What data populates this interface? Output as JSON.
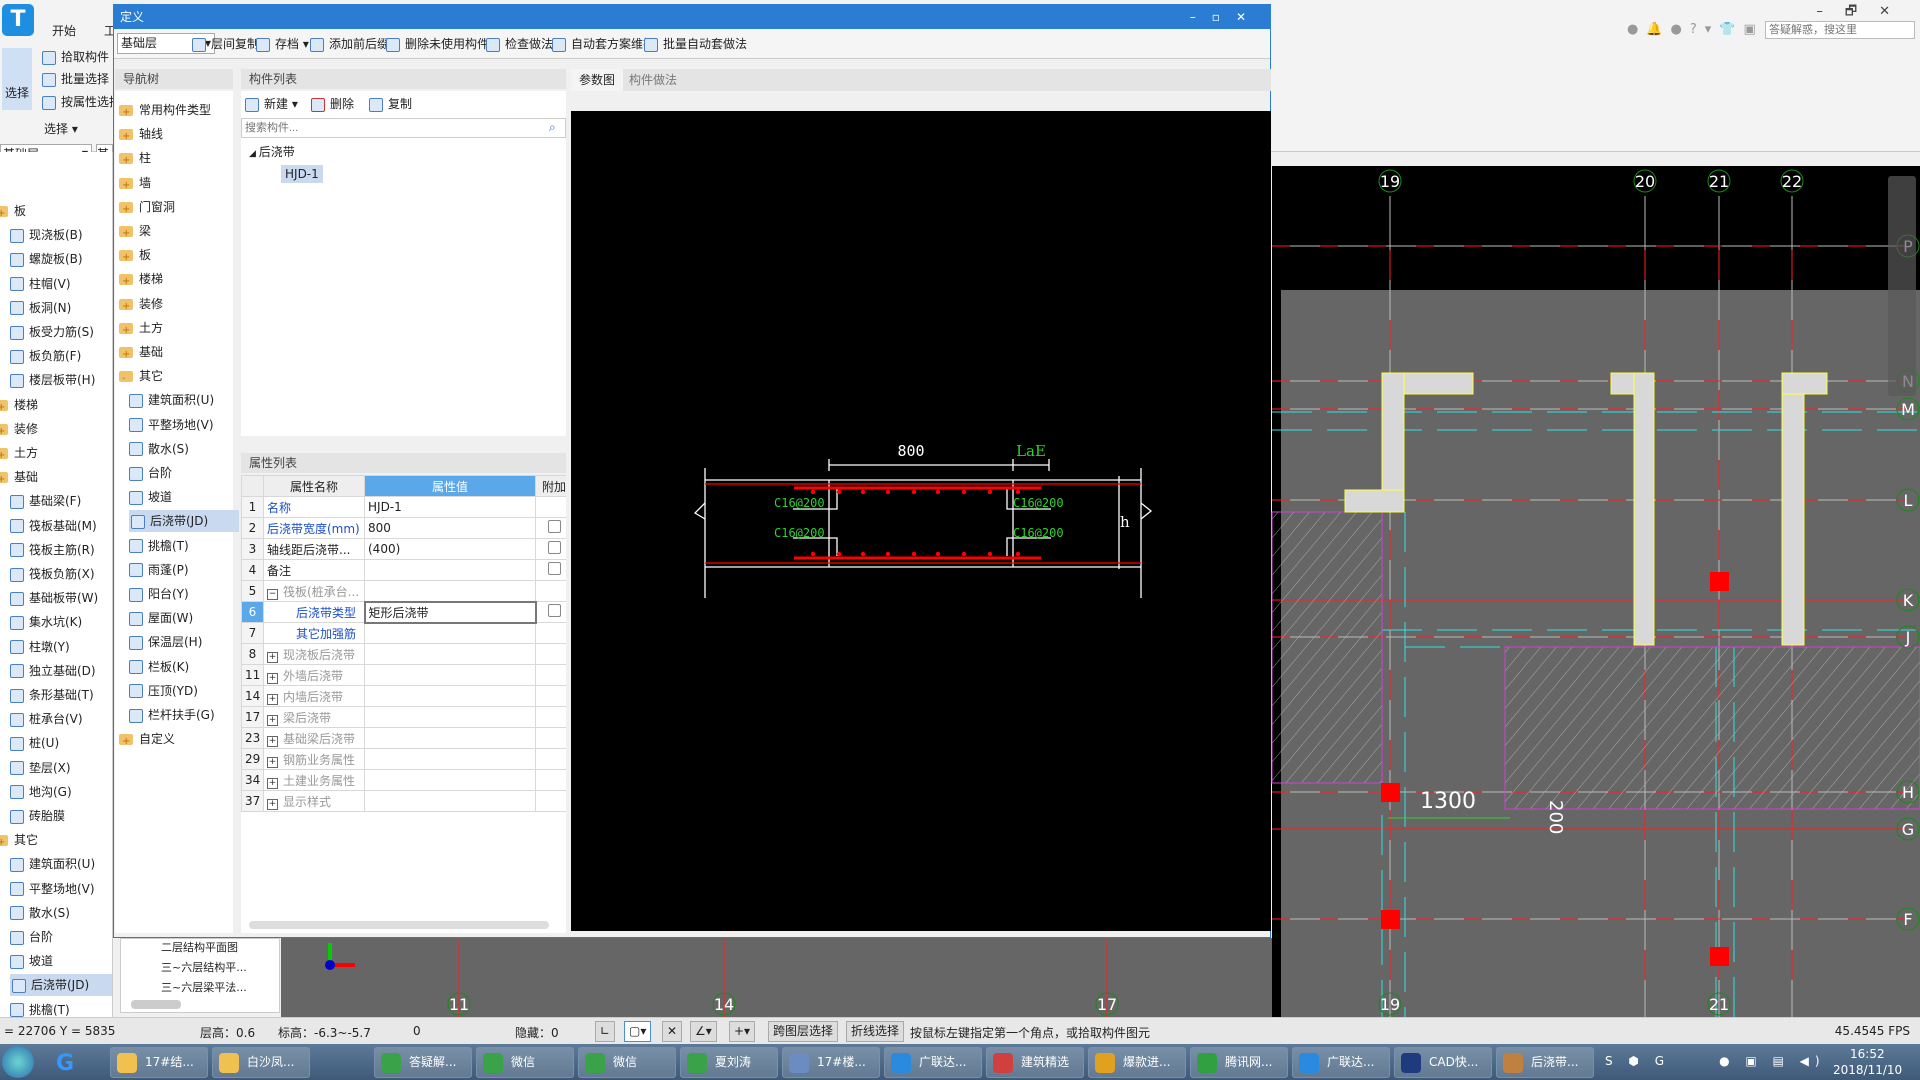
{
  "ribbon": {
    "tabs": [
      "开始",
      "工"
    ],
    "select_big": "选择",
    "buttons": [
      "拾取构件",
      "批量选择",
      "按属性选择"
    ],
    "group": "选择 ▾",
    "floor": "基础层",
    "floor2": "其",
    "search_placeholder": "答疑解惑，搜这里",
    "window_controls": [
      "–",
      "🗗",
      "✕"
    ]
  },
  "left_tree": [
    {
      "t": "板",
      "f": 1
    },
    {
      "t": "现浇板(B)"
    },
    {
      "t": "螺旋板(B)"
    },
    {
      "t": "柱帽(V)"
    },
    {
      "t": "板洞(N)"
    },
    {
      "t": "板受力筋(S)"
    },
    {
      "t": "板负筋(F)"
    },
    {
      "t": "楼层板带(H)"
    },
    {
      "t": "楼梯",
      "f": 1
    },
    {
      "t": "装修",
      "f": 1
    },
    {
      "t": "土方",
      "f": 1
    },
    {
      "t": "基础",
      "f": 1
    },
    {
      "t": "基础梁(F)"
    },
    {
      "t": "筏板基础(M)"
    },
    {
      "t": "筏板主筋(R)"
    },
    {
      "t": "筏板负筋(X)"
    },
    {
      "t": "基础板带(W)"
    },
    {
      "t": "集水坑(K)"
    },
    {
      "t": "柱墩(Y)"
    },
    {
      "t": "独立基础(D)"
    },
    {
      "t": "条形基础(T)"
    },
    {
      "t": "桩承台(V)"
    },
    {
      "t": "桩(U)"
    },
    {
      "t": "垫层(X)"
    },
    {
      "t": "地沟(G)"
    },
    {
      "t": "砖胎膜"
    },
    {
      "t": "其它",
      "f": 1
    },
    {
      "t": "建筑面积(U)"
    },
    {
      "t": "平整场地(V)"
    },
    {
      "t": "散水(S)"
    },
    {
      "t": "台阶"
    },
    {
      "t": "坡道"
    },
    {
      "t": "后浇带(JD)",
      "s": 1
    },
    {
      "t": "挑檐(T)"
    }
  ],
  "drawing_tree": [
    "二层结构平面图",
    "三~六层结构平...",
    "三~六层梁平法..."
  ],
  "dialog": {
    "title": "定义",
    "floor": "基础层",
    "toolbar": [
      "层间复制",
      "存档 ▾",
      "添加前后缀",
      "删除未使用构件",
      "检查做法",
      "自动套方案维护",
      "批量自动套做法"
    ],
    "controls": [
      "–",
      "▫",
      "✕"
    ]
  },
  "nav": {
    "header": "导航树",
    "items": [
      {
        "t": "常用构件类型",
        "f": 1
      },
      {
        "t": "轴线",
        "f": 1
      },
      {
        "t": "柱",
        "f": 1
      },
      {
        "t": "墙",
        "f": 1
      },
      {
        "t": "门窗洞",
        "f": 1
      },
      {
        "t": "梁",
        "f": 1
      },
      {
        "t": "板",
        "f": 1
      },
      {
        "t": "楼梯",
        "f": 1
      },
      {
        "t": "装修",
        "f": 1
      },
      {
        "t": "土方",
        "f": 1
      },
      {
        "t": "基础",
        "f": 1
      },
      {
        "t": "其它",
        "f": 2
      },
      {
        "t": "建筑面积(U)"
      },
      {
        "t": "平整场地(V)"
      },
      {
        "t": "散水(S)"
      },
      {
        "t": "台阶"
      },
      {
        "t": "坡道"
      },
      {
        "t": "后浇带(JD)",
        "s": 1
      },
      {
        "t": "挑檐(T)"
      },
      {
        "t": "雨蓬(P)"
      },
      {
        "t": "阳台(Y)"
      },
      {
        "t": "屋面(W)"
      },
      {
        "t": "保温层(H)"
      },
      {
        "t": "栏板(K)"
      },
      {
        "t": "压顶(YD)"
      },
      {
        "t": "栏杆扶手(G)"
      },
      {
        "t": "自定义",
        "f": 1
      }
    ]
  },
  "components": {
    "header": "构件列表",
    "new": "新建 ▾",
    "delete": "删除",
    "copy": "复制",
    "search_placeholder": "搜索构件...",
    "group": "后浇带",
    "item": "HJD-1"
  },
  "props": {
    "header": "属性列表",
    "cols": [
      "属性名称",
      "属性值",
      "附加"
    ],
    "rows": [
      {
        "n": "1",
        "name": "名称",
        "val": "HJD-1",
        "c": "blue",
        "cb": false
      },
      {
        "n": "2",
        "name": "后浇带宽度(mm)",
        "val": "800",
        "c": "blue",
        "cb": true
      },
      {
        "n": "3",
        "name": "轴线距后浇带...",
        "val": "(400)",
        "c": "",
        "cb": true
      },
      {
        "n": "4",
        "name": "备注",
        "val": "",
        "c": "",
        "cb": true
      },
      {
        "n": "5",
        "name": "筏板(桩承台...",
        "val": "",
        "c": "gray",
        "exp": "−"
      },
      {
        "n": "6",
        "name": "后浇带类型",
        "val": "矩形后浇带",
        "c": "blue",
        "cb": true,
        "sub": 1,
        "sel": 1
      },
      {
        "n": "7",
        "name": "其它加强筋",
        "val": "",
        "c": "blue",
        "sub": 1
      },
      {
        "n": "8",
        "name": "现浇板后浇带",
        "val": "",
        "c": "gray",
        "exp": "+"
      },
      {
        "n": "11",
        "name": "外墙后浇带",
        "val": "",
        "c": "gray",
        "exp": "+"
      },
      {
        "n": "14",
        "name": "内墙后浇带",
        "val": "",
        "c": "gray",
        "exp": "+"
      },
      {
        "n": "17",
        "name": "梁后浇带",
        "val": "",
        "c": "gray",
        "exp": "+"
      },
      {
        "n": "23",
        "name": "基础梁后浇带",
        "val": "",
        "c": "gray",
        "exp": "+"
      },
      {
        "n": "29",
        "name": "钢筋业务属性",
        "val": "",
        "c": "gray",
        "exp": "+"
      },
      {
        "n": "34",
        "name": "土建业务属性",
        "val": "",
        "c": "gray",
        "exp": "+"
      },
      {
        "n": "37",
        "name": "显示样式",
        "val": "",
        "c": "gray",
        "exp": "+"
      }
    ]
  },
  "figure": {
    "tabs": [
      "参数图",
      "构件做法"
    ],
    "width": "800",
    "lae": "LaE",
    "rebar": [
      "C16@200",
      "C16@200",
      "C16@200",
      "C16@200"
    ],
    "h": "h"
  },
  "cad": {
    "axes_top": [
      "19",
      "20",
      "21",
      "22"
    ],
    "axes_bottom": [
      "11",
      "14",
      "17",
      "19",
      "21"
    ],
    "rows": [
      "P",
      "N",
      "M",
      "L",
      "K",
      "J",
      "H",
      "G",
      "F"
    ],
    "dim1": "1300",
    "dim2": "200",
    "colors": {
      "wall": "#d8d8d8",
      "wall_edge": "#ffff40",
      "axis": "#ff2020",
      "beam": "#30e0e0",
      "slab": "#d040d0",
      "dim": "#30d030"
    }
  },
  "status": {
    "coord": "= 22706 Y = 5835",
    "floor_h": "层高：0.6",
    "elev": "标高：-6.3~-5.7",
    "zero": "0",
    "hidden": "隐藏：0",
    "btn1": "跨图层选择",
    "btn2": "折线选择",
    "hint": "按鼠标左键指定第一个角点，或拾取构件图元",
    "fps": "45.4545 FPS"
  },
  "taskbar": {
    "items": [
      "17#结...",
      "白沙凤...",
      "答疑解...",
      "微信",
      "微信",
      "夏刘涛",
      "17#楼...",
      "广联达...",
      "建筑精选",
      "爆款进...",
      "腾讯网...",
      "广联达...",
      "CAD快...",
      "后浇带..."
    ],
    "time": "16:52",
    "date": "2018/11/10"
  }
}
